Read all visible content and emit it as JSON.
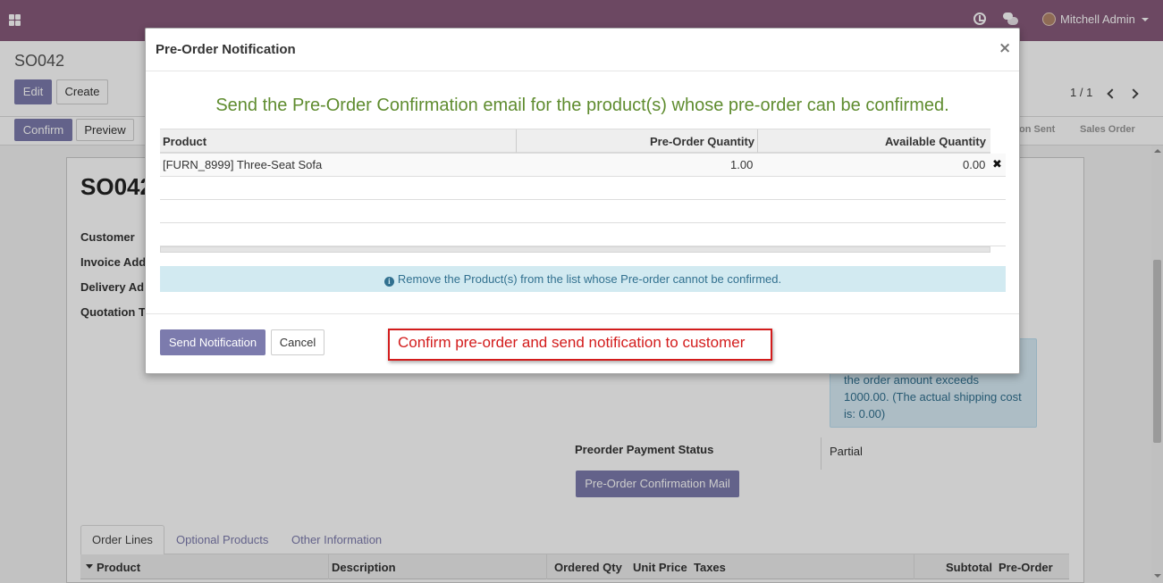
{
  "navbar": {
    "user_name": "Mitchell Admin"
  },
  "control_panel": {
    "breadcrumb": "SO042",
    "edit_label": "Edit",
    "create_label": "Create",
    "pager_value": "1 / 1"
  },
  "statusbar": {
    "confirm_label": "Confirm",
    "preview_label": "Preview",
    "stages": [
      "on Sent",
      "Sales Order"
    ]
  },
  "sheet": {
    "title": "SO042",
    "labels": [
      "Customer",
      "Invoice Add",
      "Delivery Ad",
      "Quotation T"
    ],
    "alert_lines": [
      "the order amount exceeds",
      "1000.00. (The actual shipping cost",
      "is: 0.00)"
    ],
    "preorder_status_label": "Preorder Payment Status",
    "preorder_status_value": "Partial",
    "confirm_mail_button": "Pre-Order Confirmation Mail",
    "tabs": [
      "Order Lines",
      "Optional Products",
      "Other Information"
    ],
    "order_columns": [
      "Product",
      "Description",
      "Ordered Qty",
      "Unit Price",
      "Taxes",
      "Subtotal",
      "Pre-Order"
    ],
    "partial_label": "r"
  },
  "modal": {
    "title": "Pre-Order Notification",
    "close": "×",
    "heading": "Send the Pre-Order Confirmation email for the product(s) whose pre-order can be confirmed.",
    "columns": [
      "Product",
      "Pre-Order Quantity",
      "Available Quantity"
    ],
    "rows": [
      {
        "product": "[FURN_8999] Three-Seat Sofa",
        "preorder_qty": "1.00",
        "available_qty": "0.00"
      }
    ],
    "info_text": "Remove the Product(s) from the list whose Pre-order cannot be confirmed.",
    "send_label": "Send Notification",
    "cancel_label": "Cancel",
    "callout_text": "Confirm pre-order and send notification to customer"
  },
  "colors": {
    "brand": "#875a7b",
    "primary_button": "#7c7bad",
    "heading_green": "#5f8c2f",
    "callout_red": "#d31c1c",
    "info_bg": "#d2eaf1"
  }
}
